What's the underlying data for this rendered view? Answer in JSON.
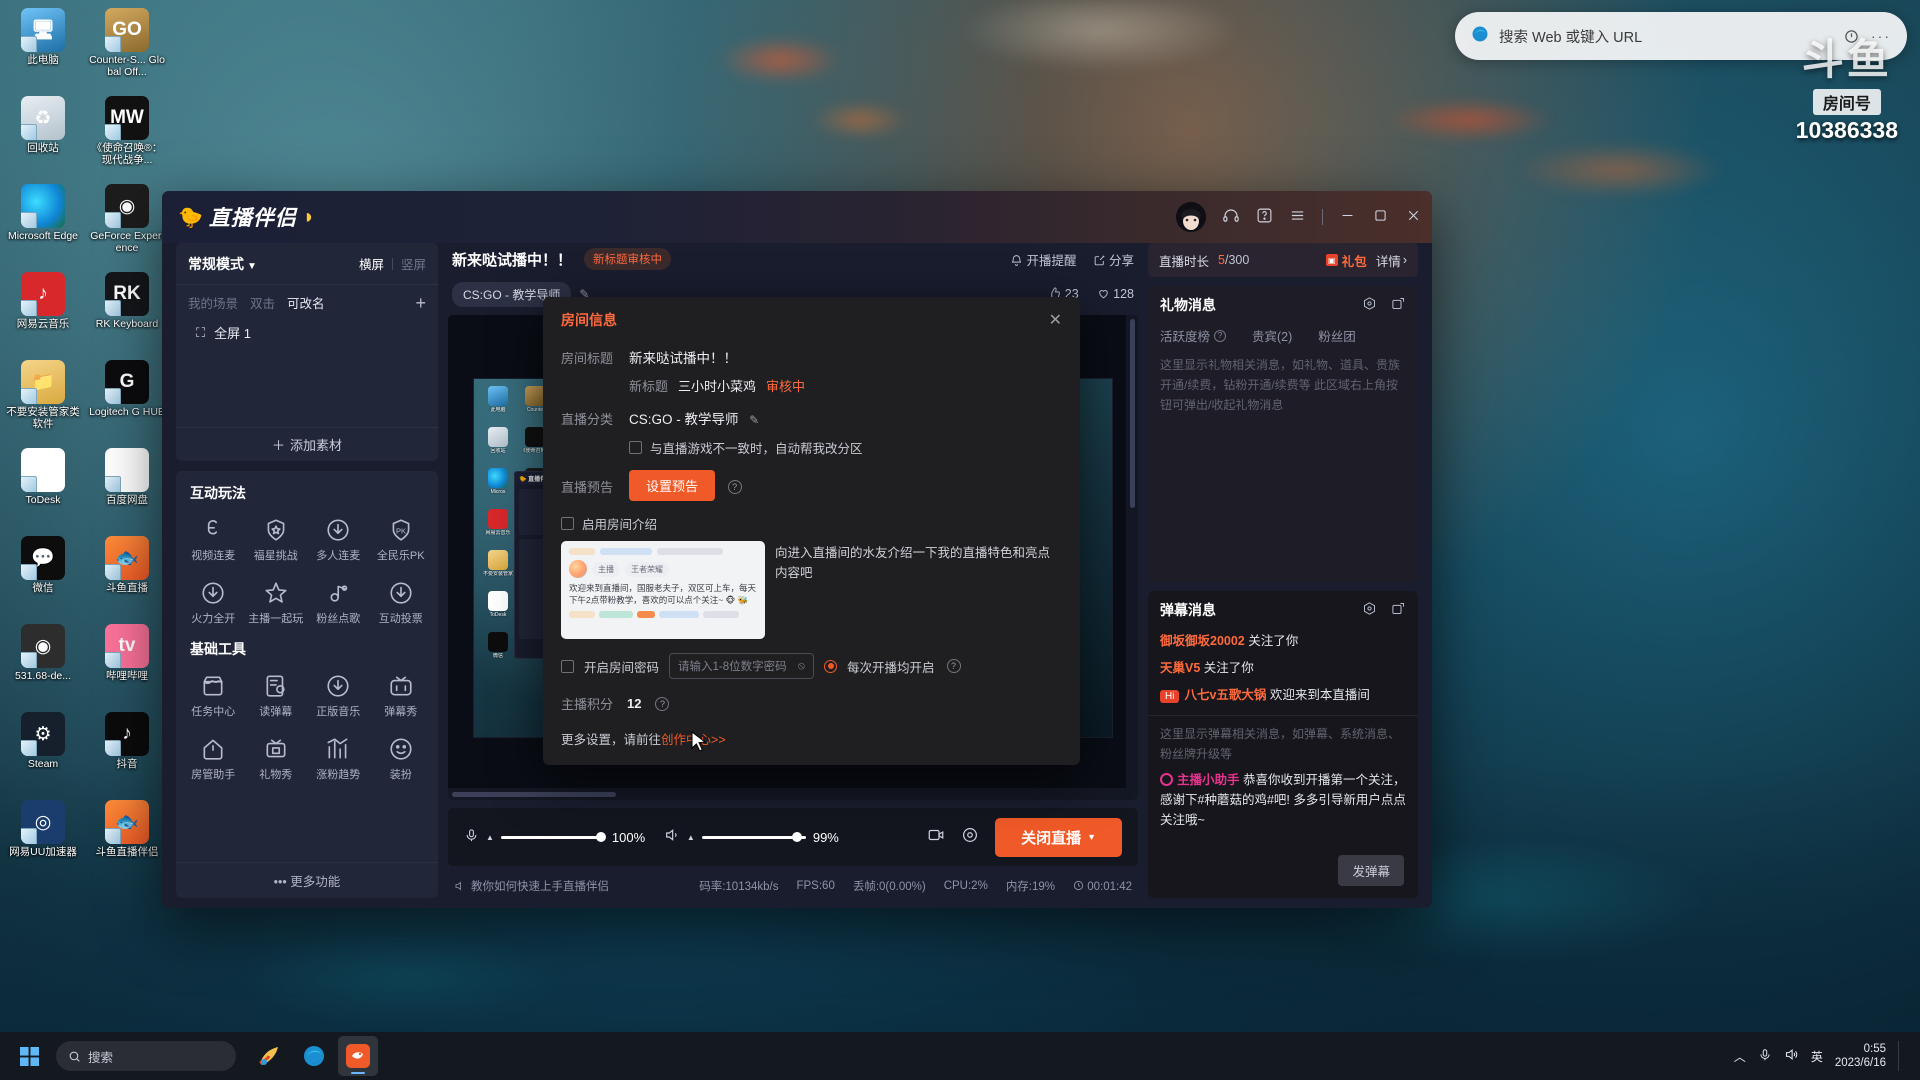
{
  "desktop": {
    "icons": [
      {
        "label": "此电脑",
        "name": "this-pc",
        "bg": "linear-gradient(160deg,#6fc3f7,#1d6fa5)",
        "glyph": "🖥"
      },
      {
        "label": "Counter-S... Global Off...",
        "name": "csgo",
        "bg": "linear-gradient(160deg,#d3a95f,#8a6a2e)",
        "glyph": "GO"
      },
      {
        "label": "回收站",
        "name": "recycle-bin",
        "bg": "linear-gradient(160deg,#e8eef3,#b4c2cc)",
        "glyph": "♻"
      },
      {
        "label": "《使命召唤®：现代战争...",
        "name": "call-of-duty",
        "bg": "#111",
        "glyph": "MW"
      },
      {
        "label": "Microsoft Edge",
        "name": "microsoft-edge",
        "bg": "radial-gradient(circle at 35% 40%,#3ddcff,#0f86d6 60%,#1b6b3a)",
        "glyph": ""
      },
      {
        "label": "GeForce Experience",
        "name": "geforce-experience",
        "bg": "#1d1d1d",
        "glyph": "◉"
      },
      {
        "label": "网易云音乐",
        "name": "netease-music",
        "bg": "#d8282b",
        "glyph": "♪"
      },
      {
        "label": "RK Keyboard",
        "name": "rk-keyboard",
        "bg": "#15161a",
        "glyph": "RK"
      },
      {
        "label": "不要安装管家类软件",
        "name": "folder-no-guard",
        "bg": "linear-gradient(160deg,#f5d58a,#d9a93f)",
        "glyph": "📁"
      },
      {
        "label": "Logitech G HUB",
        "name": "logitech-g-hub",
        "bg": "#0c0c0e",
        "glyph": "G"
      },
      {
        "label": "ToDesk",
        "name": "todesk",
        "bg": "#ffffff",
        "glyph": "◤"
      },
      {
        "label": "百度网盘",
        "name": "baidu-netdisk",
        "bg": "#ffffff",
        "glyph": "☁"
      },
      {
        "label": "微信",
        "name": "wechat",
        "bg": "#0d0d0d",
        "glyph": "💬"
      },
      {
        "label": "斗鱼直播",
        "name": "douyu-live",
        "bg": "linear-gradient(160deg,#ff8d3a,#f05a28)",
        "glyph": "🐟"
      },
      {
        "label": "531.68-de...",
        "name": "nvidia-driver",
        "bg": "#2d2d2d",
        "glyph": "◉"
      },
      {
        "label": "哔哩哔哩",
        "name": "bilibili",
        "bg": "#fb7299",
        "glyph": "tv"
      },
      {
        "label": "Steam",
        "name": "steam",
        "bg": "#16202d",
        "glyph": "⚙"
      },
      {
        "label": "抖音",
        "name": "douyin",
        "bg": "#0b0b0b",
        "glyph": "♪"
      },
      {
        "label": "网易UU加速器",
        "name": "netease-uu",
        "bg": "#1a3d6e",
        "glyph": "◎"
      },
      {
        "label": "斗鱼直播伴侣",
        "name": "douyu-live-companion",
        "bg": "linear-gradient(160deg,#ff8d3a,#f05a28)",
        "glyph": "🐟"
      }
    ]
  },
  "edge_bar": {
    "placeholder": "搜索 Web 或键入 URL"
  },
  "room_overlay": {
    "logo": "斗鱼",
    "tagline": "房间号",
    "number": "10386338"
  },
  "app": {
    "brand": "直播伴侣",
    "titlebar_icons": [
      "headset-icon",
      "help-icon",
      "menu-icon",
      "minimize-icon",
      "maximize-icon",
      "close-icon"
    ]
  },
  "scene_panel": {
    "mode": "常规模式",
    "layout_landscape": "横屏",
    "layout_portrait": "竖屏",
    "my_scene": "我的场景",
    "dblclick": "双击",
    "rename": "可改名",
    "add": "+",
    "items": [
      {
        "label": "全屏 1"
      }
    ],
    "add_material": "添加素材"
  },
  "tools": {
    "interactive_title": "互动玩法",
    "interactive": [
      {
        "label": "视频连麦",
        "icon": "mic-link-icon"
      },
      {
        "label": "福星挑战",
        "icon": "shield-star-icon"
      },
      {
        "label": "多人连麦",
        "icon": "download-circle-icon"
      },
      {
        "label": "全民乐PK",
        "icon": "pk-shield-icon"
      },
      {
        "label": "火力全开",
        "icon": "download-circle-icon"
      },
      {
        "label": "主播一起玩",
        "icon": "star-icon"
      },
      {
        "label": "粉丝点歌",
        "icon": "music-note-icon"
      },
      {
        "label": "互动投票",
        "icon": "download-circle-icon"
      }
    ],
    "basic_title": "基础工具",
    "basic": [
      {
        "label": "任务中心",
        "icon": "shop-icon"
      },
      {
        "label": "读弹幕",
        "icon": "read-danmaku-icon"
      },
      {
        "label": "正版音乐",
        "icon": "download-circle-icon"
      },
      {
        "label": "弹幕秀",
        "icon": "tv-icon"
      },
      {
        "label": "房管助手",
        "icon": "home-icon"
      },
      {
        "label": "礼物秀",
        "icon": "gift-tv-icon"
      },
      {
        "label": "涨粉趋势",
        "icon": "chart-icon"
      },
      {
        "label": "装扮",
        "icon": "smiley-icon"
      }
    ],
    "more": "更多功能"
  },
  "center": {
    "title": "新来哒试播中！！",
    "audit_badge": "新标题审核中",
    "notify": "开播提醒",
    "share": "分享",
    "category": "CS:GO - 教学导师",
    "likes": "23",
    "hearts": "128"
  },
  "controlbar": {
    "mic_icon": "microphone-icon",
    "mic_pct": "100%",
    "speaker_icon": "speaker-icon",
    "speaker_pct": "99%",
    "camera_icon": "camera-icon",
    "settings_icon": "settings-icon",
    "stop_label": "关闭直播"
  },
  "statusbar": {
    "tutorial": "教你如何快速上手直播伴侣",
    "bitrate": "码率:10134kb/s",
    "fps": "FPS:60",
    "dropped": "丢帧:0(0.00%)",
    "cpu": "CPU:2%",
    "memory": "内存:19%",
    "elapsed": "00:01:42"
  },
  "right": {
    "live_duration_label": "直播时长",
    "live_duration_value": "5",
    "live_duration_total": "/300",
    "gift_pack": "礼包",
    "detail": "详情",
    "gift_panel": {
      "title": "礼物消息",
      "tabs": [
        "活跃度榜",
        "贵宾(2)",
        "粉丝团"
      ],
      "placeholder": "这里显示礼物相关消息，如礼物、道具、贵族开通/续费，钻粉开通/续费等\n此区域右上角按钮可弹出/收起礼物消息"
    },
    "danmu_panel": {
      "title": "弹幕消息",
      "messages": [
        {
          "name": "御坂御坂20002",
          "action": "关注了你",
          "badge": ""
        },
        {
          "name": "天巢V5",
          "action": "关注了你",
          "badge": ""
        },
        {
          "name": "八七v五歌大锅",
          "action": "欢迎来到本直播间",
          "badge": "Hi"
        }
      ],
      "placeholder": "这里显示弹幕相关消息，如弹幕、系统消息、粉丝牌升级等",
      "assistant_name": "主播小助手",
      "assistant_msg": "恭喜你收到开播第一个关注，感谢下#种蘑菇的鸡#吧! 多多引导新用户点点关注哦~",
      "send_label": "发弹幕"
    }
  },
  "modal": {
    "title": "房间信息",
    "close_icon": "close-icon",
    "rows": {
      "room_title_label": "房间标题",
      "room_title_value": "新来哒试播中！！",
      "new_title_key": "新标题",
      "new_title_value": "三小时小菜鸡",
      "new_title_status": "审核中",
      "category_label": "直播分类",
      "category_value": "CS:GO - 教学导师",
      "auto_switch_label": "与直播游戏不一致时，自动帮我改分区",
      "preset_label": "直播预告",
      "preset_button": "设置预告",
      "intro_checkbox": "启用房间介绍",
      "intro_text": "向进入直播间的水友介绍一下我的直播特色和亮点内容吧",
      "intro_card": {
        "tag_host": "主播",
        "tag_game": "王者荣耀",
        "message": "欢迎来到直播间，国服老夫子，双区可上车，每天下午2点带粉教学，喜欢的可以点个关注~ 🐵 🐝"
      },
      "password_checkbox": "开启房间密码",
      "password_placeholder": "请输入1-8位数字密码",
      "password_radio": "每次开播均开启",
      "score_label": "主播积分",
      "score_value": "12",
      "more_prefix": "更多设置，请前往",
      "more_link": "创作中心",
      "more_suffix": ">>"
    }
  },
  "taskbar": {
    "search_placeholder": "搜索",
    "apps": [
      "paint-icon",
      "edge-icon",
      "douyu-icon"
    ],
    "lang": "英",
    "time": "0:55",
    "date": "2023/6/16"
  }
}
